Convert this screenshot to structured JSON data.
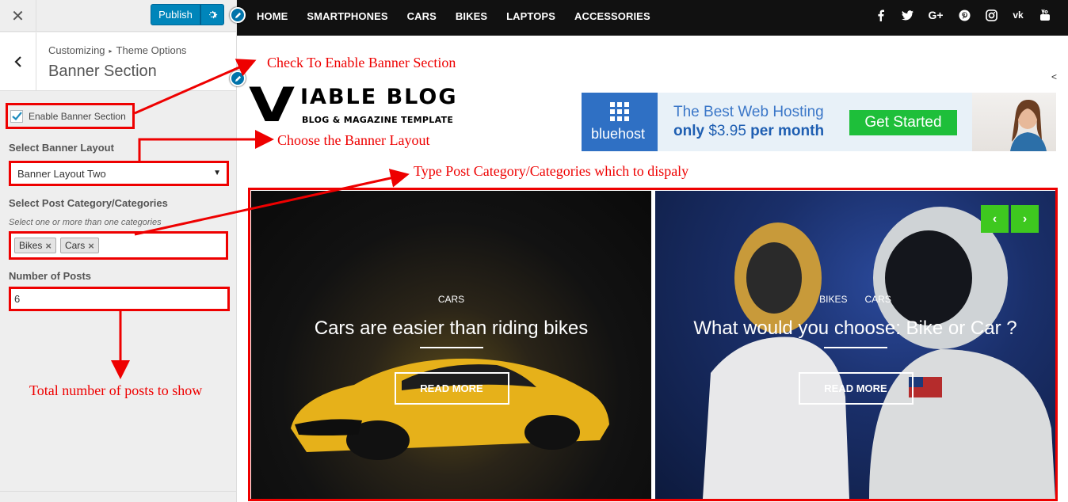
{
  "sidebar": {
    "close_icon": "close-icon",
    "publish_label": "Publish",
    "gear_icon": "gear-icon",
    "back_icon": "chevron-left-icon",
    "breadcrumb_root": "Customizing",
    "breadcrumb_child": "Theme Options",
    "section_title": "Banner Section",
    "enable_banner_label": "Enable Banner Section",
    "enable_banner_checked": true,
    "layout_label": "Select Banner Layout",
    "layout_value": "Banner Layout Two",
    "category_label": "Select Post Category/Categories",
    "category_description": "Select one or more than one categories",
    "category_tags": [
      "Bikes",
      "Cars"
    ],
    "posts_label": "Number of Posts",
    "posts_value": "6"
  },
  "annotations": {
    "enable": "Check To Enable Banner Section",
    "layout": "Choose the Banner Layout",
    "category": "Type Post Category/Categories which to dispaly",
    "posts": "Total number of posts to show"
  },
  "preview": {
    "nav": [
      "HOME",
      "SMARTPHONES",
      "CARS",
      "BIKES",
      "LAPTOPS",
      "ACCESSORIES"
    ],
    "social_icons": [
      "facebook-icon",
      "twitter-icon",
      "google-plus-icon",
      "pinterest-icon",
      "instagram-icon",
      "vk-icon",
      "youtube-icon"
    ],
    "collapse_glyph": "<",
    "logo": {
      "initial": "V",
      "name": "IABLE BLOG",
      "tagline": "BLOG & MAGAZINE TEMPLATE"
    },
    "ad": {
      "brand": "bluehost",
      "line1": "The Best Web Hosting",
      "line2_prefix": "only",
      "line2_price": "$3.95",
      "line2_suffix": "per month",
      "cta": "Get Started"
    },
    "slides": [
      {
        "categories": [
          "CARS"
        ],
        "title": "Cars are easier than riding bikes",
        "button": "READ MORE"
      },
      {
        "categories": [
          "BIKES",
          "CARS"
        ],
        "title": "What would you choose: Bike or Car ?",
        "button": "READ MORE"
      }
    ],
    "prev_glyph": "‹",
    "next_glyph": "›"
  },
  "colors": {
    "annotation_red": "#ee0000",
    "publish_blue": "#0085ba",
    "slider_arrow_green": "#3ec81f",
    "ad_cta_green": "#1ebf3a",
    "nav_bg": "#111111"
  }
}
